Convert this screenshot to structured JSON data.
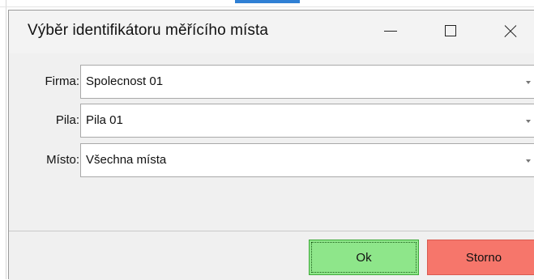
{
  "window": {
    "title": "Výběr identifikátoru měřícího místa",
    "controls": [
      "minimize",
      "maximize",
      "close"
    ]
  },
  "form": {
    "rows": [
      {
        "label": "Firma:",
        "value": "Spolecnost 01"
      },
      {
        "label": "Pila:",
        "value": "Pila 01"
      },
      {
        "label": "Místo:",
        "value": "Všechna místa"
      }
    ]
  },
  "footer": {
    "ok_label": "Ok",
    "cancel_label": "Storno"
  },
  "colors": {
    "ok_button": "#8ee68a",
    "cancel_button": "#f6766b",
    "window_bg": "#f0f0f0"
  }
}
